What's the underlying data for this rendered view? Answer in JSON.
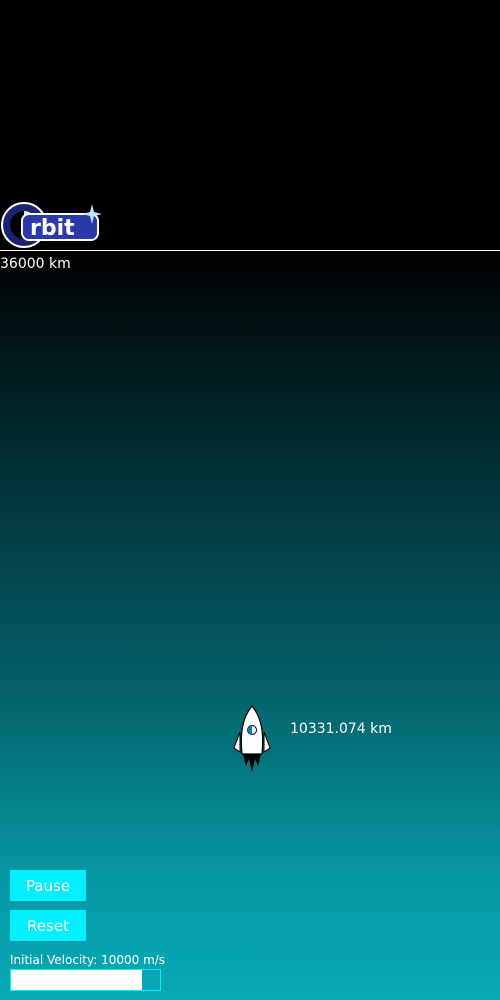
{
  "game": {
    "orbit_label": "36000 km",
    "altitude_label": "10331.074 km"
  },
  "controls": {
    "pause_label": "Pause",
    "reset_label": "Reset",
    "velocity_label": "Initial Velocity: 10000 m/s",
    "velocity_fraction": 0.88
  },
  "logo": {
    "icon": "orbit-logo"
  },
  "colors": {
    "button": "#00f0ff",
    "sky_top": "#000000",
    "sky_bottom": "#07aab6"
  }
}
